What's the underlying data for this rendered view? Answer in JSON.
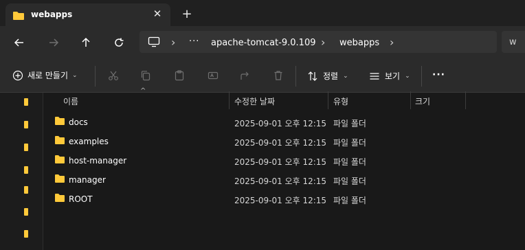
{
  "tab": {
    "title": "webapps",
    "close_glyph": "✕",
    "new_tab_glyph": "+"
  },
  "breadcrumb": {
    "more": "···",
    "items": [
      "apache-tomcat-9.0.109",
      "webapps"
    ],
    "separator": "›"
  },
  "search": {
    "value": "w"
  },
  "toolbar": {
    "new_label": "새로 만들기",
    "sort_label": "정렬",
    "view_label": "보기",
    "more_glyph": "···"
  },
  "columns": {
    "name": "이름",
    "date": "수정한 날짜",
    "type": "유형",
    "size": "크기"
  },
  "rows": [
    {
      "name": "docs",
      "date": "2025-09-01 오후 12:15",
      "type": "파일 폴더"
    },
    {
      "name": "examples",
      "date": "2025-09-01 오후 12:15",
      "type": "파일 폴더"
    },
    {
      "name": "host-manager",
      "date": "2025-09-01 오후 12:15",
      "type": "파일 폴더"
    },
    {
      "name": "manager",
      "date": "2025-09-01 오후 12:15",
      "type": "파일 폴더"
    },
    {
      "name": "ROOT",
      "date": "2025-09-01 오후 12:15",
      "type": "파일 폴더"
    }
  ],
  "colors": {
    "folder": "#ffc93a",
    "background": "#191919",
    "chrome": "#2b2b2b"
  }
}
